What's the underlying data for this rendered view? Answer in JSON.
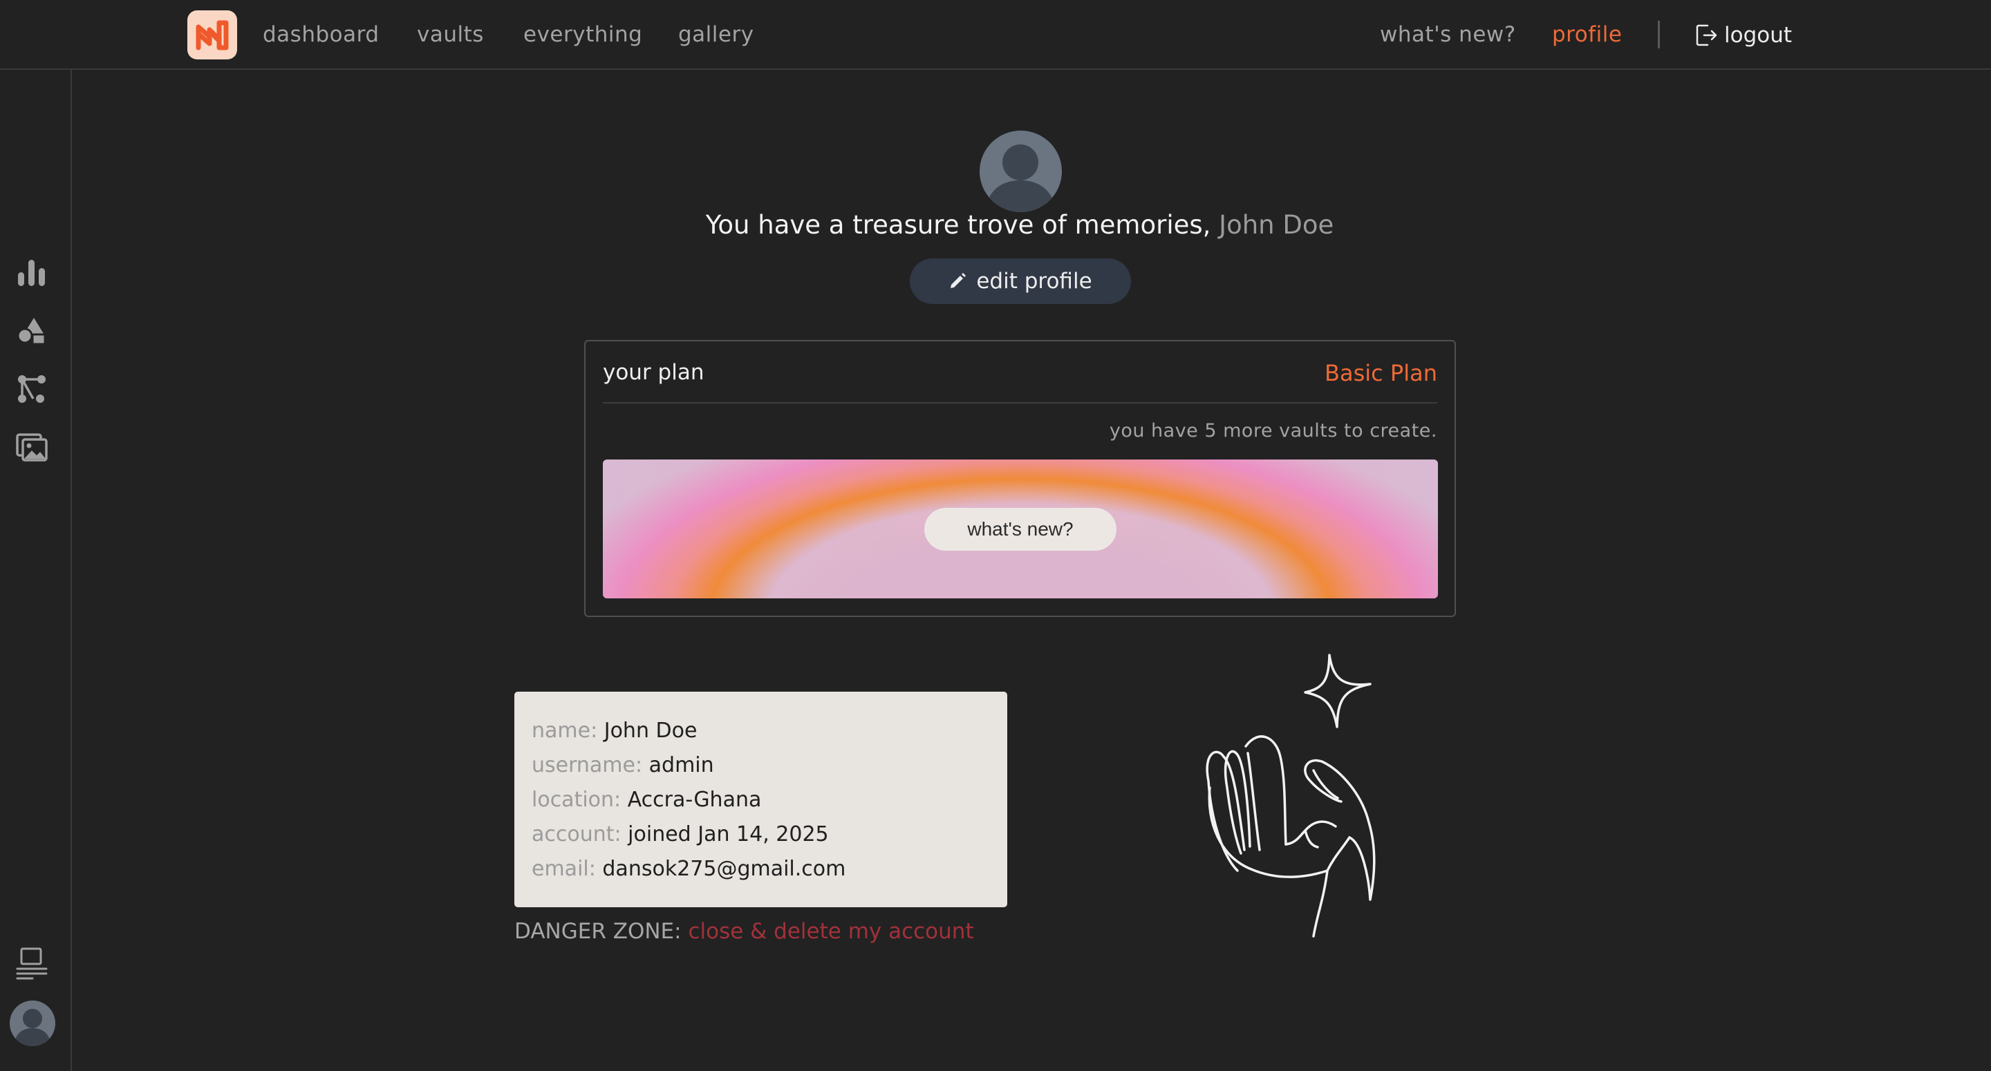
{
  "nav": {
    "logo_alt": "app logo",
    "links": [
      {
        "label": "dashboard"
      },
      {
        "label": "vaults"
      },
      {
        "label": "everything"
      },
      {
        "label": "gallery"
      }
    ],
    "right_links": [
      {
        "label": "what's new?"
      },
      {
        "label": "profile",
        "active": true
      }
    ],
    "separator": "|",
    "logout_label": "logout"
  },
  "sidebar": {
    "items": [
      {
        "icon": "bar-chart-icon"
      },
      {
        "icon": "shapes-icon"
      },
      {
        "icon": "nodes-icon"
      },
      {
        "icon": "gallery-icon"
      },
      {
        "icon": "layout-icon"
      }
    ]
  },
  "profile": {
    "greeting": "You have a treasure trove of memories,",
    "name": "John Doe",
    "edit_label": "edit profile"
  },
  "plan": {
    "label": "your plan",
    "name": "Basic Plan",
    "remaining": "you have 5 more vaults to create.",
    "banner_button": "what's new?"
  },
  "info": {
    "rows": [
      {
        "key": "name:",
        "value": "John Doe"
      },
      {
        "key": "username:",
        "value": "admin"
      },
      {
        "key": "location:",
        "value": "Accra-Ghana"
      },
      {
        "key": "account:",
        "value": "joined Jan 14, 2025"
      },
      {
        "key": "email:",
        "value": "dansok275@gmail.com"
      }
    ]
  },
  "danger": {
    "label": "DANGER ZONE:",
    "action": "close & delete my account"
  },
  "colors": {
    "accent": "#ef6a37",
    "danger": "#a2313b",
    "background": "#222222"
  }
}
